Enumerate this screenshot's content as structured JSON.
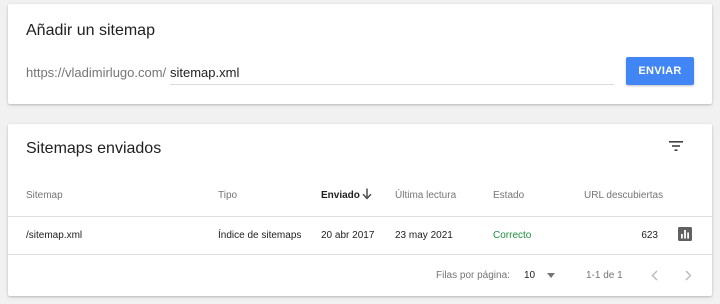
{
  "add_sitemap": {
    "title": "Añadir un sitemap",
    "url_prefix": "https://vladimirlugo.com/",
    "input_value": "sitemap.xml",
    "submit_label": "ENVIAR"
  },
  "sent_sitemaps": {
    "title": "Sitemaps enviados",
    "filter_icon": "filter-list-icon",
    "columns": [
      "Sitemap",
      "Tipo",
      "Enviado",
      "Última lectura",
      "Estado",
      "URL descubiertas"
    ],
    "sorted_column": "Enviado",
    "sort_direction": "descending",
    "rows": [
      {
        "sitemap": "/sitemap.xml",
        "type": "Índice de sitemaps",
        "submitted": "20 abr 2017",
        "last_read": "23 may 2021",
        "status": "Correcto",
        "discovered_urls": "623"
      }
    ],
    "pagination": {
      "rows_per_page_label": "Filas por página:",
      "rows_per_page": "10",
      "range": "1-1 de 1"
    }
  },
  "colors": {
    "accent": "#4285f4",
    "status_ok": "#1e8e3e",
    "background": "#f1f1f1"
  }
}
